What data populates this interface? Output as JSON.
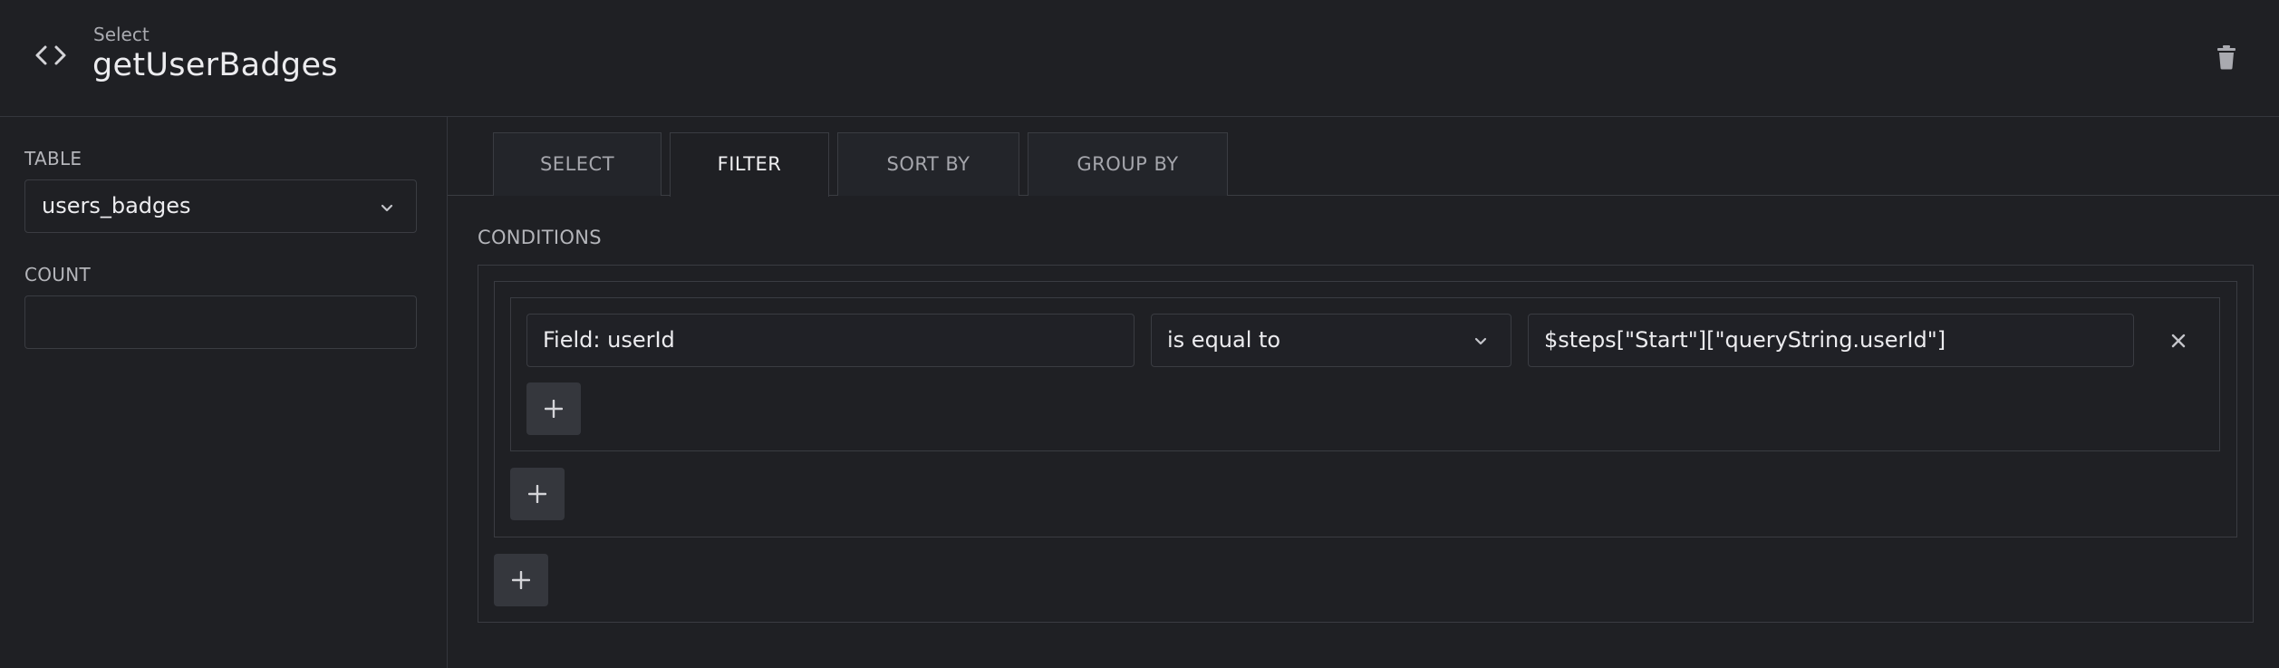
{
  "header": {
    "subtitle": "Select",
    "title": "getUserBadges",
    "left_icon": "code-icon",
    "right_icon": "trash-icon"
  },
  "sidebar": {
    "table_label": "TABLE",
    "table_value": "users_badges",
    "count_label": "COUNT",
    "count_value": ""
  },
  "tabs": [
    {
      "label": "SELECT",
      "active": false
    },
    {
      "label": "FILTER",
      "active": true
    },
    {
      "label": "SORT BY",
      "active": false
    },
    {
      "label": "GROUP BY",
      "active": false
    }
  ],
  "conditions": {
    "label": "CONDITIONS",
    "rows": [
      {
        "field": "Field: userId",
        "operator": "is equal to",
        "value": "$steps[\"Start\"][\"queryString.userId\"]"
      }
    ]
  },
  "colors": {
    "background": "#1f2024",
    "border": "#3a3c42",
    "button": "#35373d",
    "text": "#ececef"
  }
}
